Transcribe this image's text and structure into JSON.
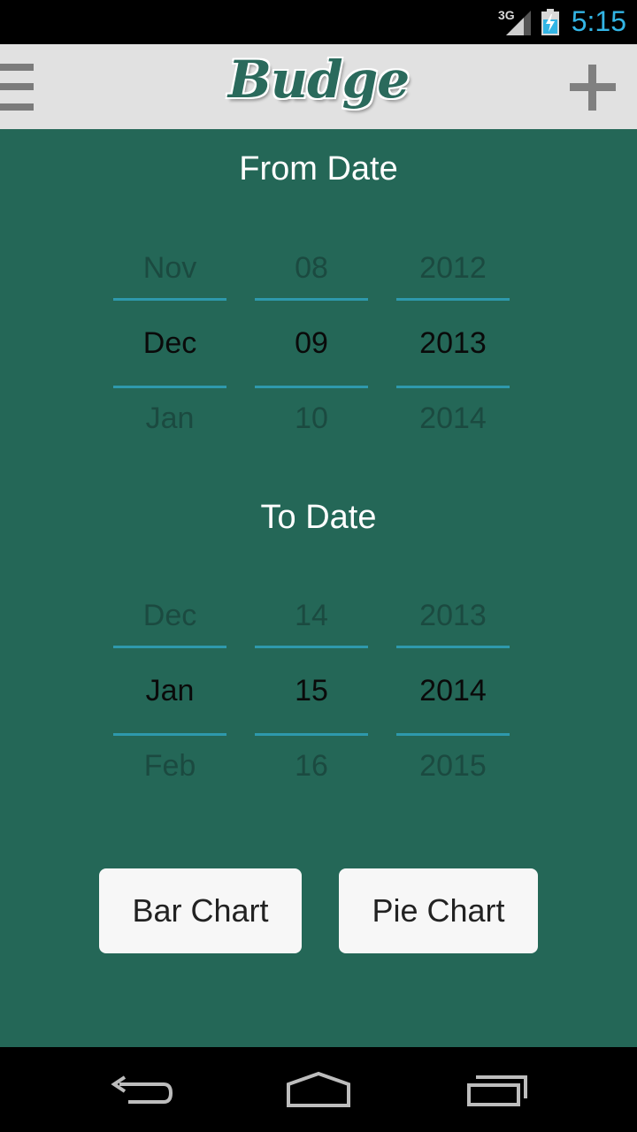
{
  "status_bar": {
    "network_type": "3G",
    "time": "5:15",
    "icons": [
      "signal-icon",
      "battery-charging-icon"
    ]
  },
  "action_bar": {
    "title": "Budge",
    "icons": [
      "menu-icon",
      "add-icon"
    ]
  },
  "from_date": {
    "title": "From Date",
    "month": {
      "prev": "Nov",
      "current": "Dec",
      "next": "Jan"
    },
    "day": {
      "prev": "08",
      "current": "09",
      "next": "10"
    },
    "year": {
      "prev": "2012",
      "current": "2013",
      "next": "2014"
    }
  },
  "to_date": {
    "title": "To Date",
    "month": {
      "prev": "Dec",
      "current": "Jan",
      "next": "Feb"
    },
    "day": {
      "prev": "14",
      "current": "15",
      "next": "16"
    },
    "year": {
      "prev": "2013",
      "current": "2014",
      "next": "2015"
    }
  },
  "buttons": {
    "bar_chart": "Bar Chart",
    "pie_chart": "Pie Chart"
  },
  "nav_bar": {
    "icons": [
      "back-icon",
      "home-icon",
      "recent-apps-icon"
    ]
  },
  "colors": {
    "background": "#246757",
    "accent": "#2e99ac",
    "action_bar": "#e1e1e1",
    "clock": "#33b5e5"
  }
}
